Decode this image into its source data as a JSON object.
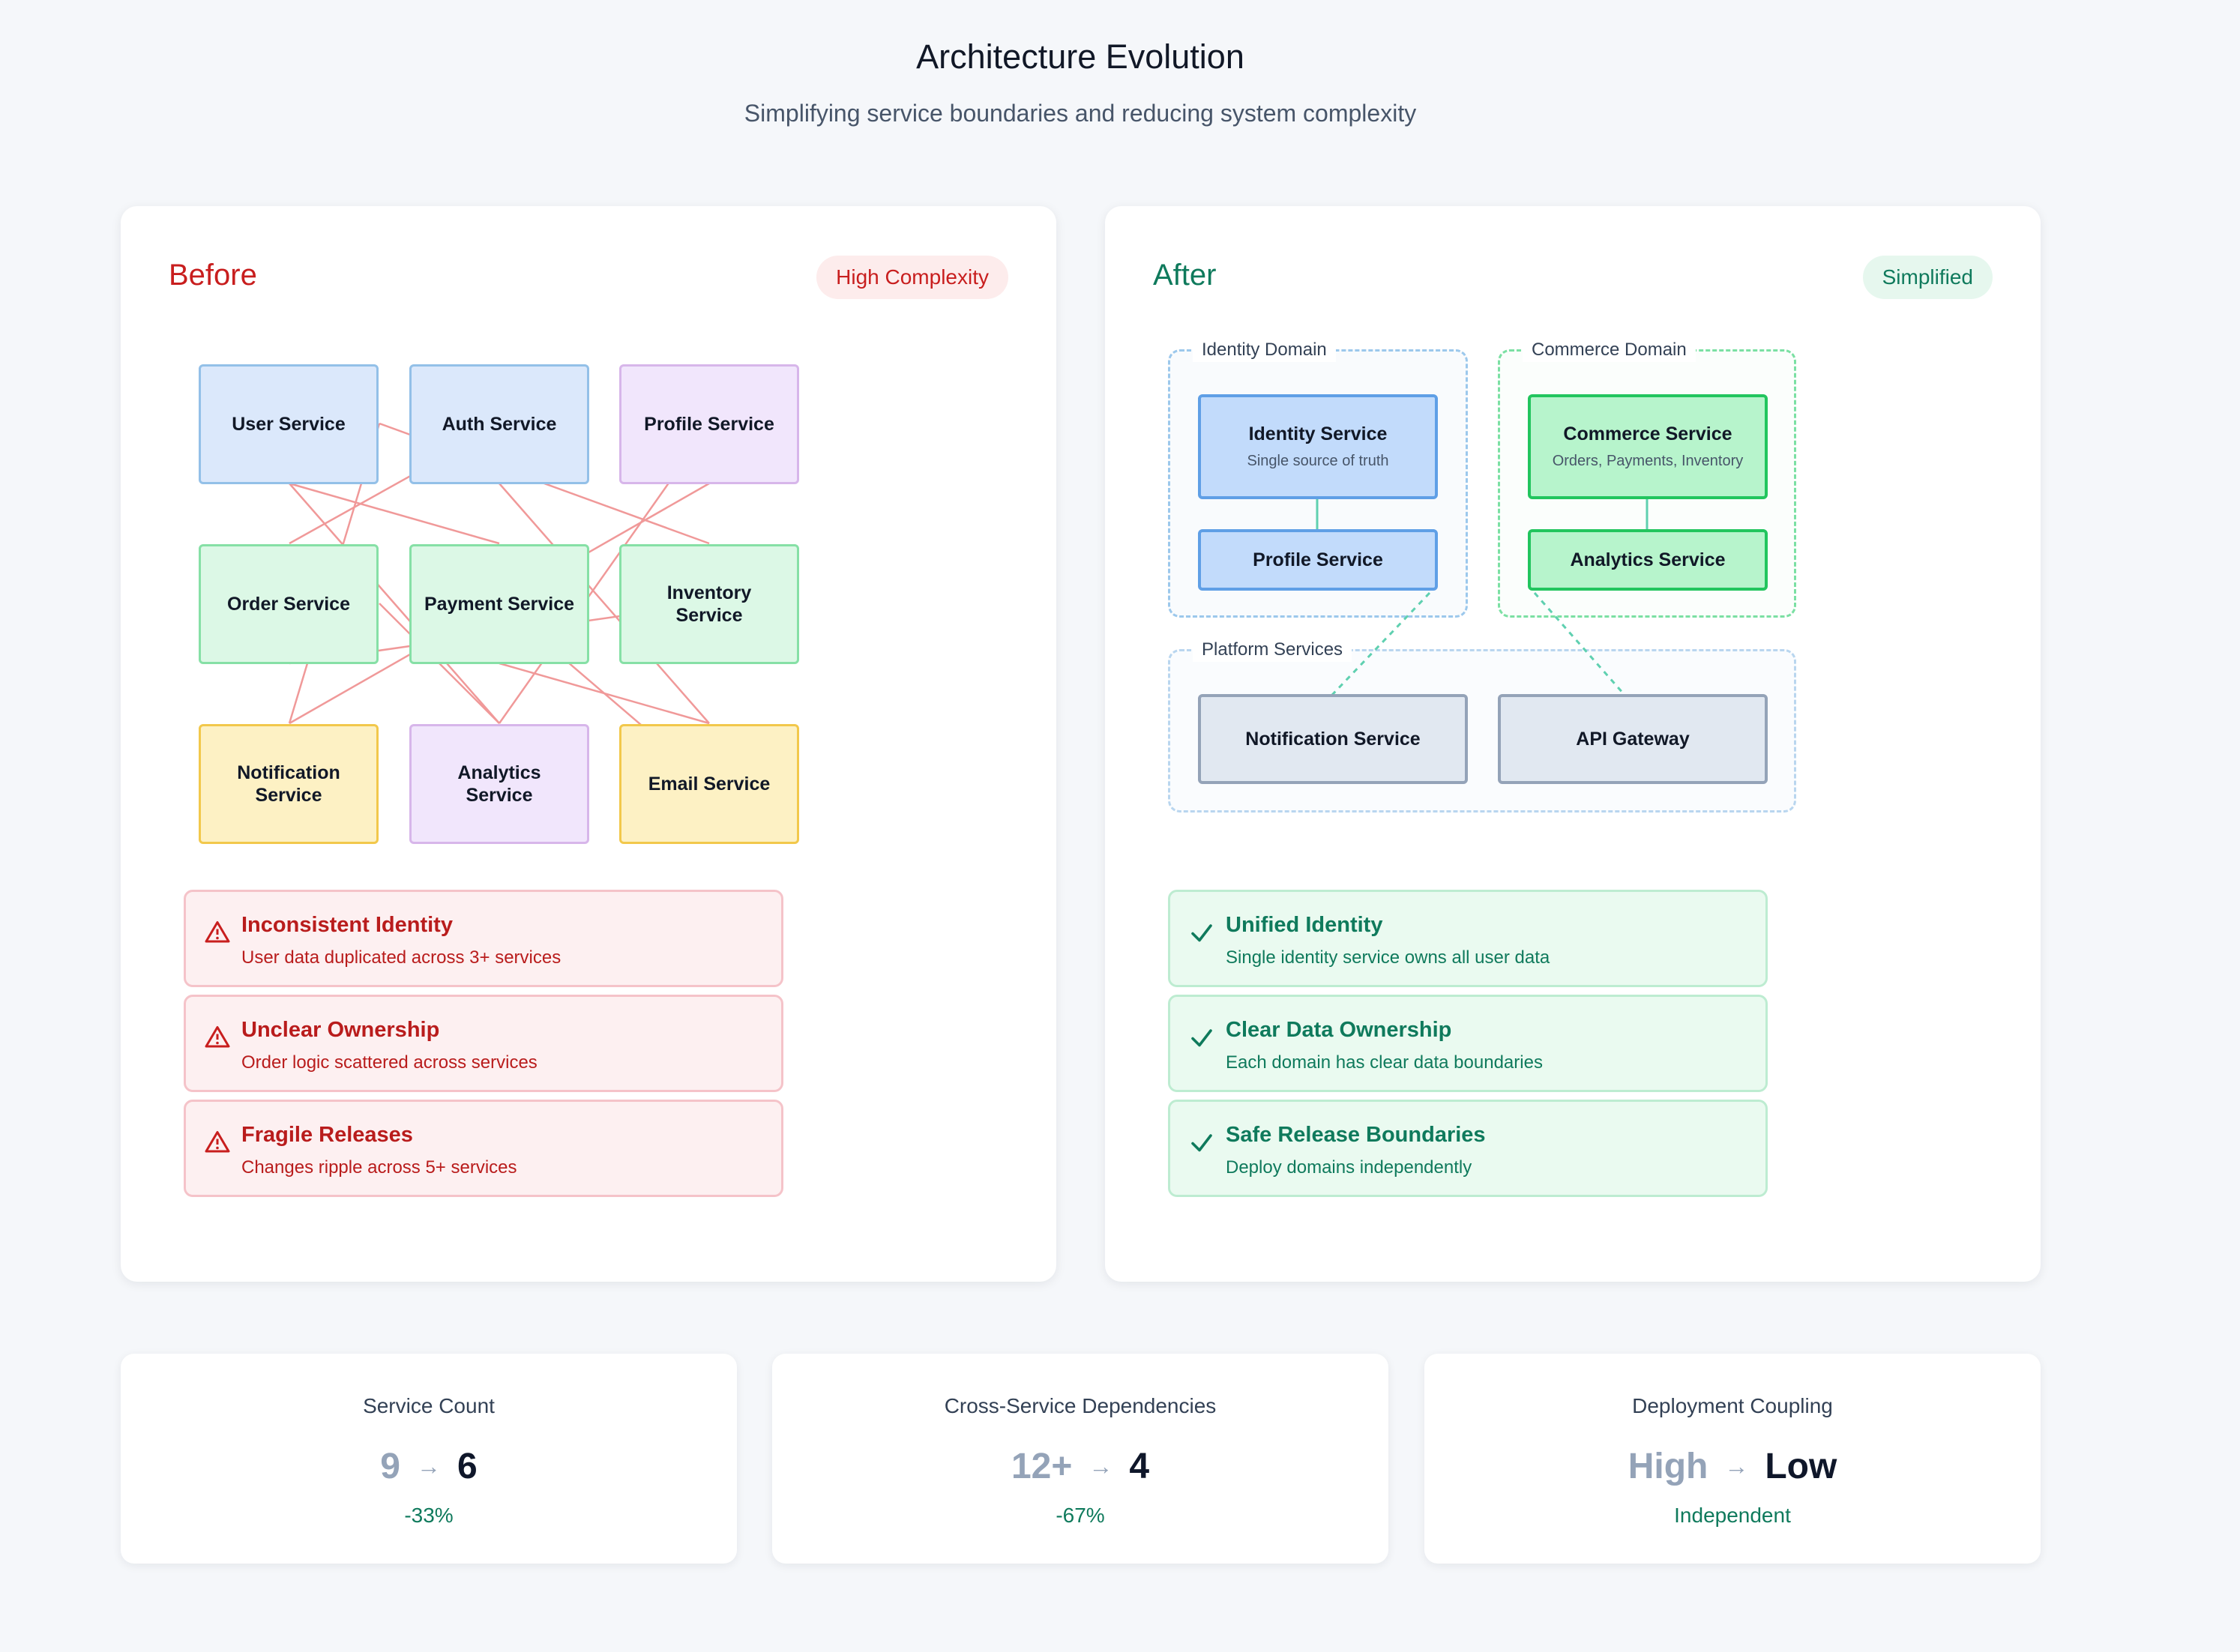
{
  "header": {
    "title": "Architecture Evolution",
    "subtitle": "Simplifying service boundaries and reducing system complexity"
  },
  "before": {
    "heading": "Before",
    "badge": "High Complexity",
    "services": [
      {
        "l1": "User Service",
        "l2": ""
      },
      {
        "l1": "Auth Service",
        "l2": ""
      },
      {
        "l1": "Profile Service",
        "l2": ""
      },
      {
        "l1": "Order Service",
        "l2": ""
      },
      {
        "l1": "Payment Service",
        "l2": ""
      },
      {
        "l1": "Inventory",
        "l2": "Service"
      },
      {
        "l1": "Notification",
        "l2": "Service"
      },
      {
        "l1": "Analytics",
        "l2": "Service"
      },
      {
        "l1": "Email Service",
        "l2": ""
      }
    ],
    "issues": [
      {
        "title": "Inconsistent Identity",
        "desc": "User data duplicated across 3+ services"
      },
      {
        "title": "Unclear Ownership",
        "desc": "Order logic scattered across services"
      },
      {
        "title": "Fragile Releases",
        "desc": "Changes ripple across 5+ services"
      }
    ],
    "colors": {
      "accent": "#c81e1e",
      "edge": "#ef8a8a"
    }
  },
  "after": {
    "heading": "After",
    "badge": "Simplified",
    "domains": {
      "identity": {
        "label": "Identity Domain",
        "main": {
          "name": "Identity Service",
          "sub": "Single source of truth"
        },
        "child": "Profile Service"
      },
      "commerce": {
        "label": "Commerce Domain",
        "main": {
          "name": "Commerce Service",
          "sub": "Orders, Payments, Inventory"
        },
        "child": "Analytics Service"
      },
      "platform": {
        "label": "Platform Services",
        "services": [
          "Notification Service",
          "API Gateway"
        ]
      }
    },
    "benefits": [
      {
        "title": "Unified Identity",
        "desc": "Single identity service owns all user data"
      },
      {
        "title": "Clear Data Ownership",
        "desc": "Each domain has clear data boundaries"
      },
      {
        "title": "Safe Release Boundaries",
        "desc": "Deploy domains independently"
      }
    ],
    "colors": {
      "accent": "#0f7a5c",
      "edge": "#5fd0b0"
    }
  },
  "metrics": [
    {
      "label": "Service Count",
      "old": "9",
      "new": "6",
      "change": "-33%"
    },
    {
      "label": "Cross-Service Dependencies",
      "old": "12+",
      "new": "4",
      "change": "-67%"
    },
    {
      "label": "Deployment Coupling",
      "old": "High",
      "new": "Low",
      "change": "Independent"
    }
  ],
  "icons": {
    "warning": "warning-triangle-icon",
    "check": "check-icon",
    "arrow": "arrow-right-icon"
  }
}
